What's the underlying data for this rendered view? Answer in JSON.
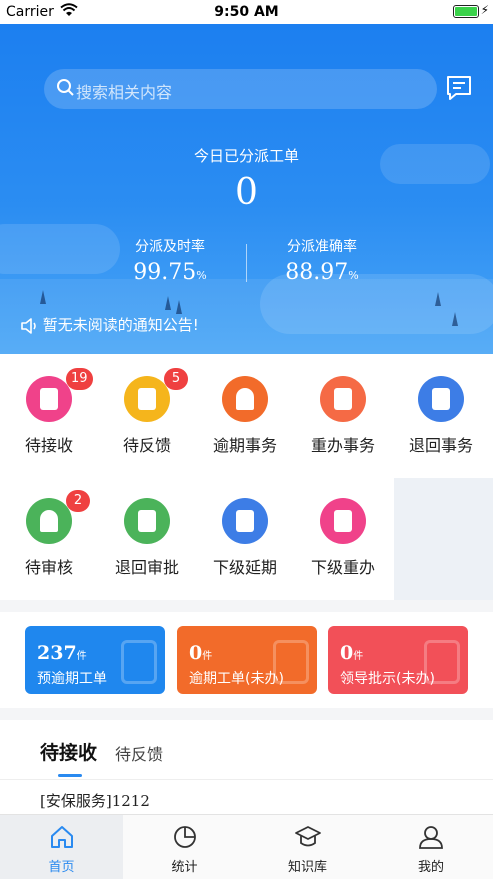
{
  "status_bar": {
    "carrier": "Carrier",
    "time": "9:50 AM"
  },
  "search": {
    "placeholder": "搜索相关内容"
  },
  "dashboard": {
    "title": "今日已分派工单",
    "count": "0",
    "stats": [
      {
        "label": "分派及时率",
        "value": "99.75",
        "unit": "%"
      },
      {
        "label": "分派准确率",
        "value": "88.97",
        "unit": "%"
      }
    ],
    "notice": "暂无未阅读的通知公告!"
  },
  "grid": [
    {
      "label": "待接收",
      "badge": "19",
      "color": "#f0428a"
    },
    {
      "label": "待反馈",
      "badge": "5",
      "color": "#f5b51c"
    },
    {
      "label": "逾期事务",
      "badge": "",
      "color": "#f26b2a"
    },
    {
      "label": "重办事务",
      "badge": "",
      "color": "#f56a45"
    },
    {
      "label": "退回事务",
      "badge": "",
      "color": "#3d7de6"
    },
    {
      "label": "待审核",
      "badge": "2",
      "color": "#4bb35a"
    },
    {
      "label": "退回审批",
      "badge": "",
      "color": "#4bb35a"
    },
    {
      "label": "下级延期",
      "badge": "",
      "color": "#3d7de6"
    },
    {
      "label": "下级重办",
      "badge": "",
      "color": "#f0428a"
    }
  ],
  "cards": [
    {
      "num": "237",
      "unit": "件",
      "label": "预逾期工单",
      "color": "#1f87ee"
    },
    {
      "num": "0",
      "unit": "件",
      "label": "逾期工单(未办)",
      "color": "#f26b2a"
    },
    {
      "num": "0",
      "unit": "件",
      "label": "领导批示(未办)",
      "color": "#f25058"
    }
  ],
  "tabs": {
    "active": "待接收",
    "other": "待反馈"
  },
  "list": [
    "[安保服务]1212"
  ],
  "nav": [
    {
      "label": "首页",
      "icon": "home-icon"
    },
    {
      "label": "统计",
      "icon": "pie-chart-icon"
    },
    {
      "label": "知识库",
      "icon": "graduation-cap-icon"
    },
    {
      "label": "我的",
      "icon": "user-icon"
    }
  ]
}
